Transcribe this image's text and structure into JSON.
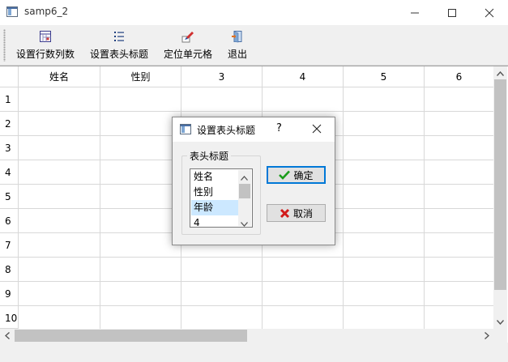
{
  "window": {
    "title": "samp6_2"
  },
  "toolbar": {
    "items": [
      {
        "label": "设置行数列数",
        "icon": "grid-settings-icon"
      },
      {
        "label": "设置表头标题",
        "icon": "list-icon"
      },
      {
        "label": "定位单元格",
        "icon": "locate-cell-icon"
      },
      {
        "label": "退出",
        "icon": "exit-door-icon"
      }
    ]
  },
  "table": {
    "column_headers": [
      "姓名",
      "性别",
      "3",
      "4",
      "5",
      "6"
    ],
    "row_headers": [
      "1",
      "2",
      "3",
      "4",
      "5",
      "6",
      "7",
      "8",
      "9",
      "10"
    ]
  },
  "dialog": {
    "title": "设置表头标题",
    "help": "?",
    "group_title": "表头标题",
    "list_items": [
      "姓名",
      "性别",
      "年龄",
      "4"
    ],
    "selected_index": 2,
    "ok_label": "确定",
    "cancel_label": "取消"
  },
  "colors": {
    "accent": "#0078d7",
    "selection": "#cce8ff",
    "ok_check": "#1a9c1a",
    "cancel_x": "#d11a1a"
  }
}
